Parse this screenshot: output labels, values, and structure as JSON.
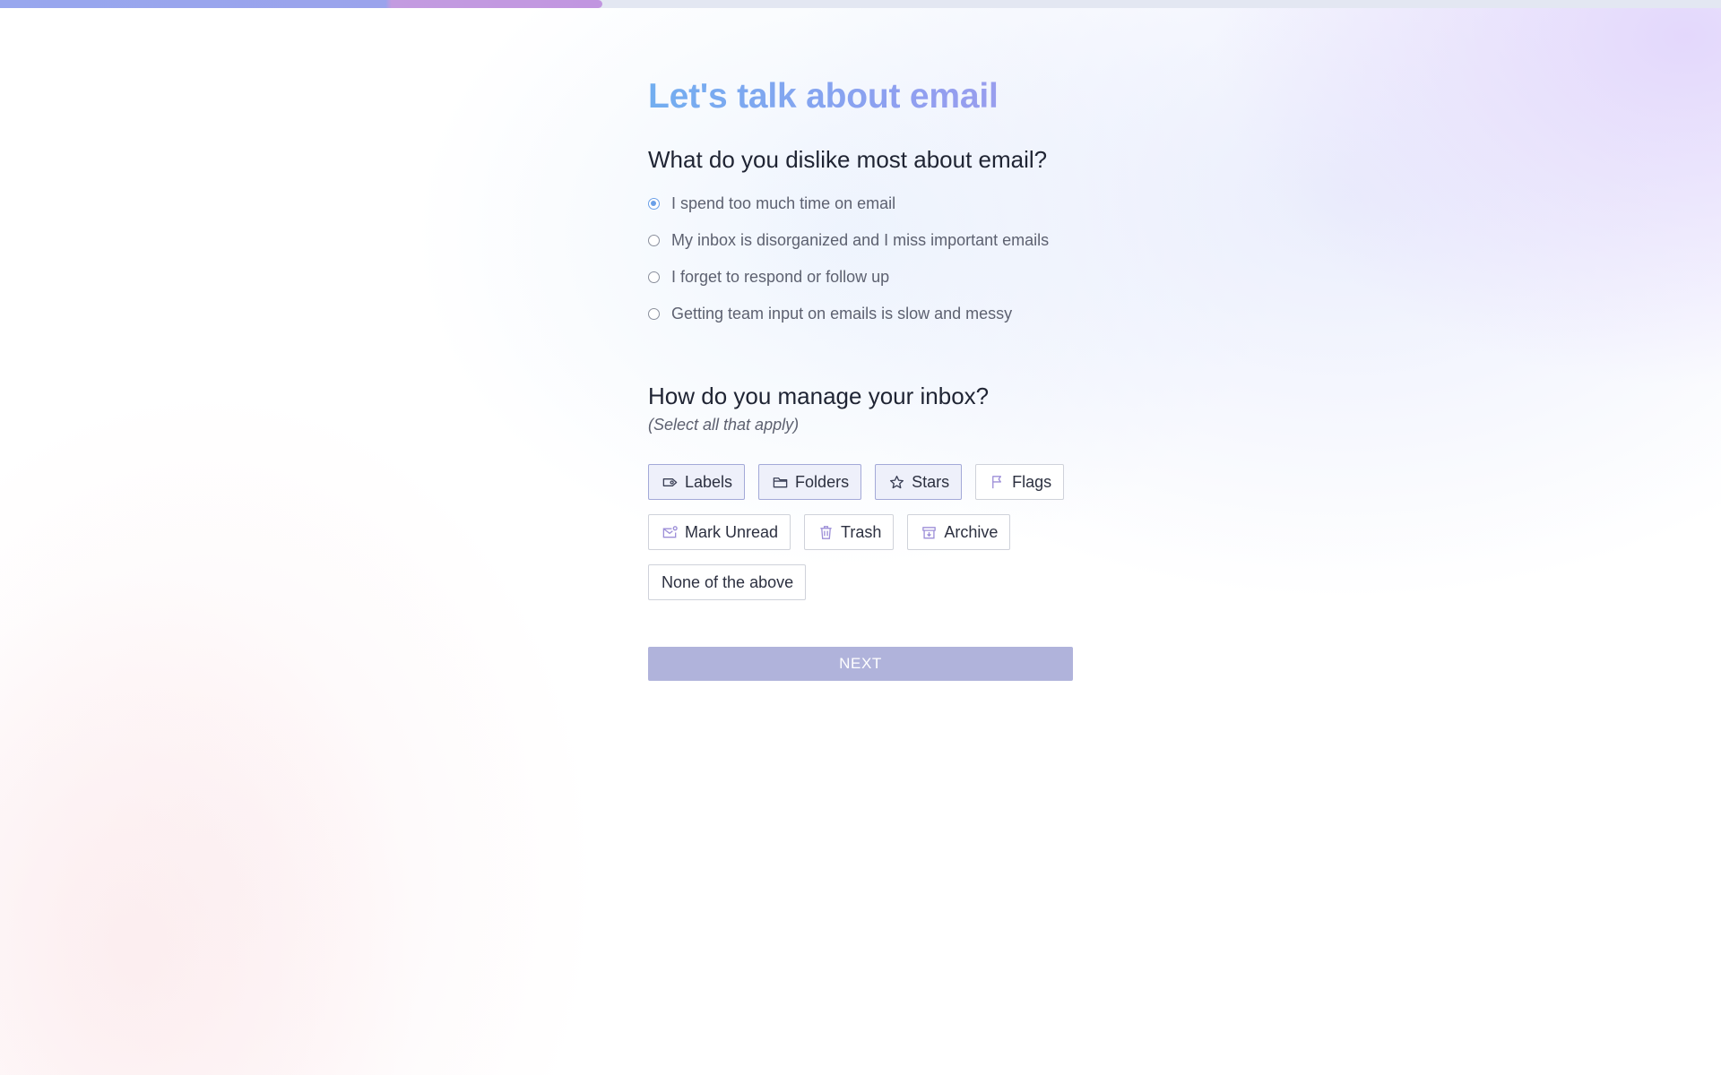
{
  "progress": {
    "fraction": 0.35
  },
  "page": {
    "title": "Let's talk about email"
  },
  "question1": {
    "text": "What do you dislike most about email?",
    "selected_index": 0,
    "options": [
      "I spend too much time on email",
      "My inbox is disorganized and I miss important emails",
      "I forget to respond or follow up",
      "Getting team input on emails is slow and messy"
    ]
  },
  "question2": {
    "text": "How do you manage your inbox?",
    "hint": "(Select all that apply)",
    "options": [
      {
        "label": "Labels",
        "icon": "label-icon",
        "selected": true
      },
      {
        "label": "Folders",
        "icon": "folder-icon",
        "selected": true
      },
      {
        "label": "Stars",
        "icon": "star-icon",
        "selected": true
      },
      {
        "label": "Flags",
        "icon": "flag-icon",
        "selected": false
      },
      {
        "label": "Mark Unread",
        "icon": "mark-unread-icon",
        "selected": false
      },
      {
        "label": "Trash",
        "icon": "trash-icon",
        "selected": false
      },
      {
        "label": "Archive",
        "icon": "archive-icon",
        "selected": false
      },
      {
        "label": "None of the above",
        "icon": "",
        "selected": false
      }
    ]
  },
  "next_button": {
    "label": "NEXT"
  },
  "colors": {
    "accent_blue": "#6aa0e8",
    "button_disabled": "#b0b3db",
    "chip_selected_bg": "#eef0fa",
    "icon_purple": "#9d8fd8"
  }
}
